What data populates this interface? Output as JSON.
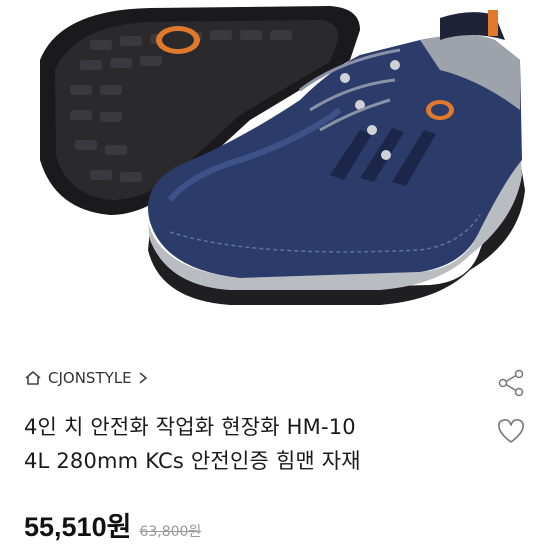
{
  "product": {
    "image_alt_icon": "safety-shoe-image",
    "store_icon": "home-outline-icon",
    "store_name": "CJONSTYLE",
    "store_chevron": "chevron-right-icon",
    "title_line1": "4인 치 안전화 작업화 현장화 HM-10",
    "title_line2": "4L 280mm KCs 안전인증 힘맨 자재",
    "price": "55,510원",
    "original_price": "63,800원"
  },
  "actions": {
    "share_icon": "share-icon",
    "like_icon": "heart-outline-icon"
  },
  "colors": {
    "shoe_navy": "#2b3c6b",
    "sole_gray": "#b9bcc0",
    "accent_orange": "#e07a2a"
  }
}
